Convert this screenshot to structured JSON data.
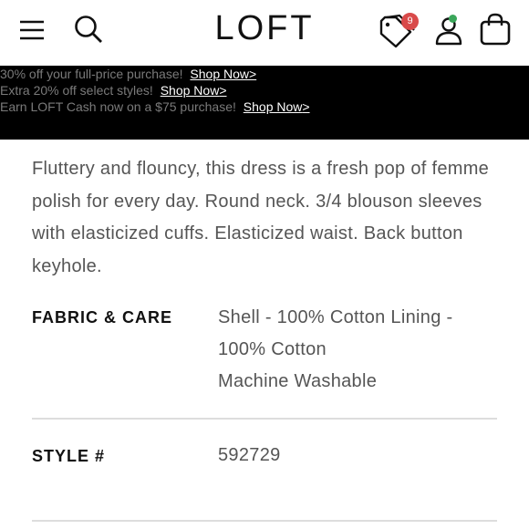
{
  "header": {
    "logo": "LOFT",
    "offers_badge_count": "9",
    "icons": [
      "menu-icon",
      "search-icon",
      "tag-icon",
      "user-icon",
      "bag-icon"
    ]
  },
  "promo": {
    "lines": [
      {
        "text": "30% off your full-price purchase!",
        "link": "Shop Now",
        "arrow": ">"
      },
      {
        "text": "Extra 20% off select styles!",
        "link": "Shop Now",
        "arrow": ">"
      },
      {
        "text": "Earn LOFT Cash now on a $75 purchase!",
        "link": "Shop Now",
        "arrow": ">"
      }
    ]
  },
  "description": "Fluttery and flouncy, this dress is a fresh pop of femme polish for every day. Round neck. 3/4 blouson sleeves with elasticized cuffs. Elasticized waist. Back button keyhole.",
  "specs": {
    "fabric_label": "FABRIC & CARE",
    "fabric_line1": "Shell - 100% Cotton Lining -",
    "fabric_line2": "100% Cotton",
    "fabric_line3": "Machine Washable",
    "style_label": "STYLE #",
    "style_value": "592729"
  },
  "colors": {
    "badge": "#d94a4a",
    "status_dot": "#3aa65a",
    "promo_bg": "#000000"
  }
}
